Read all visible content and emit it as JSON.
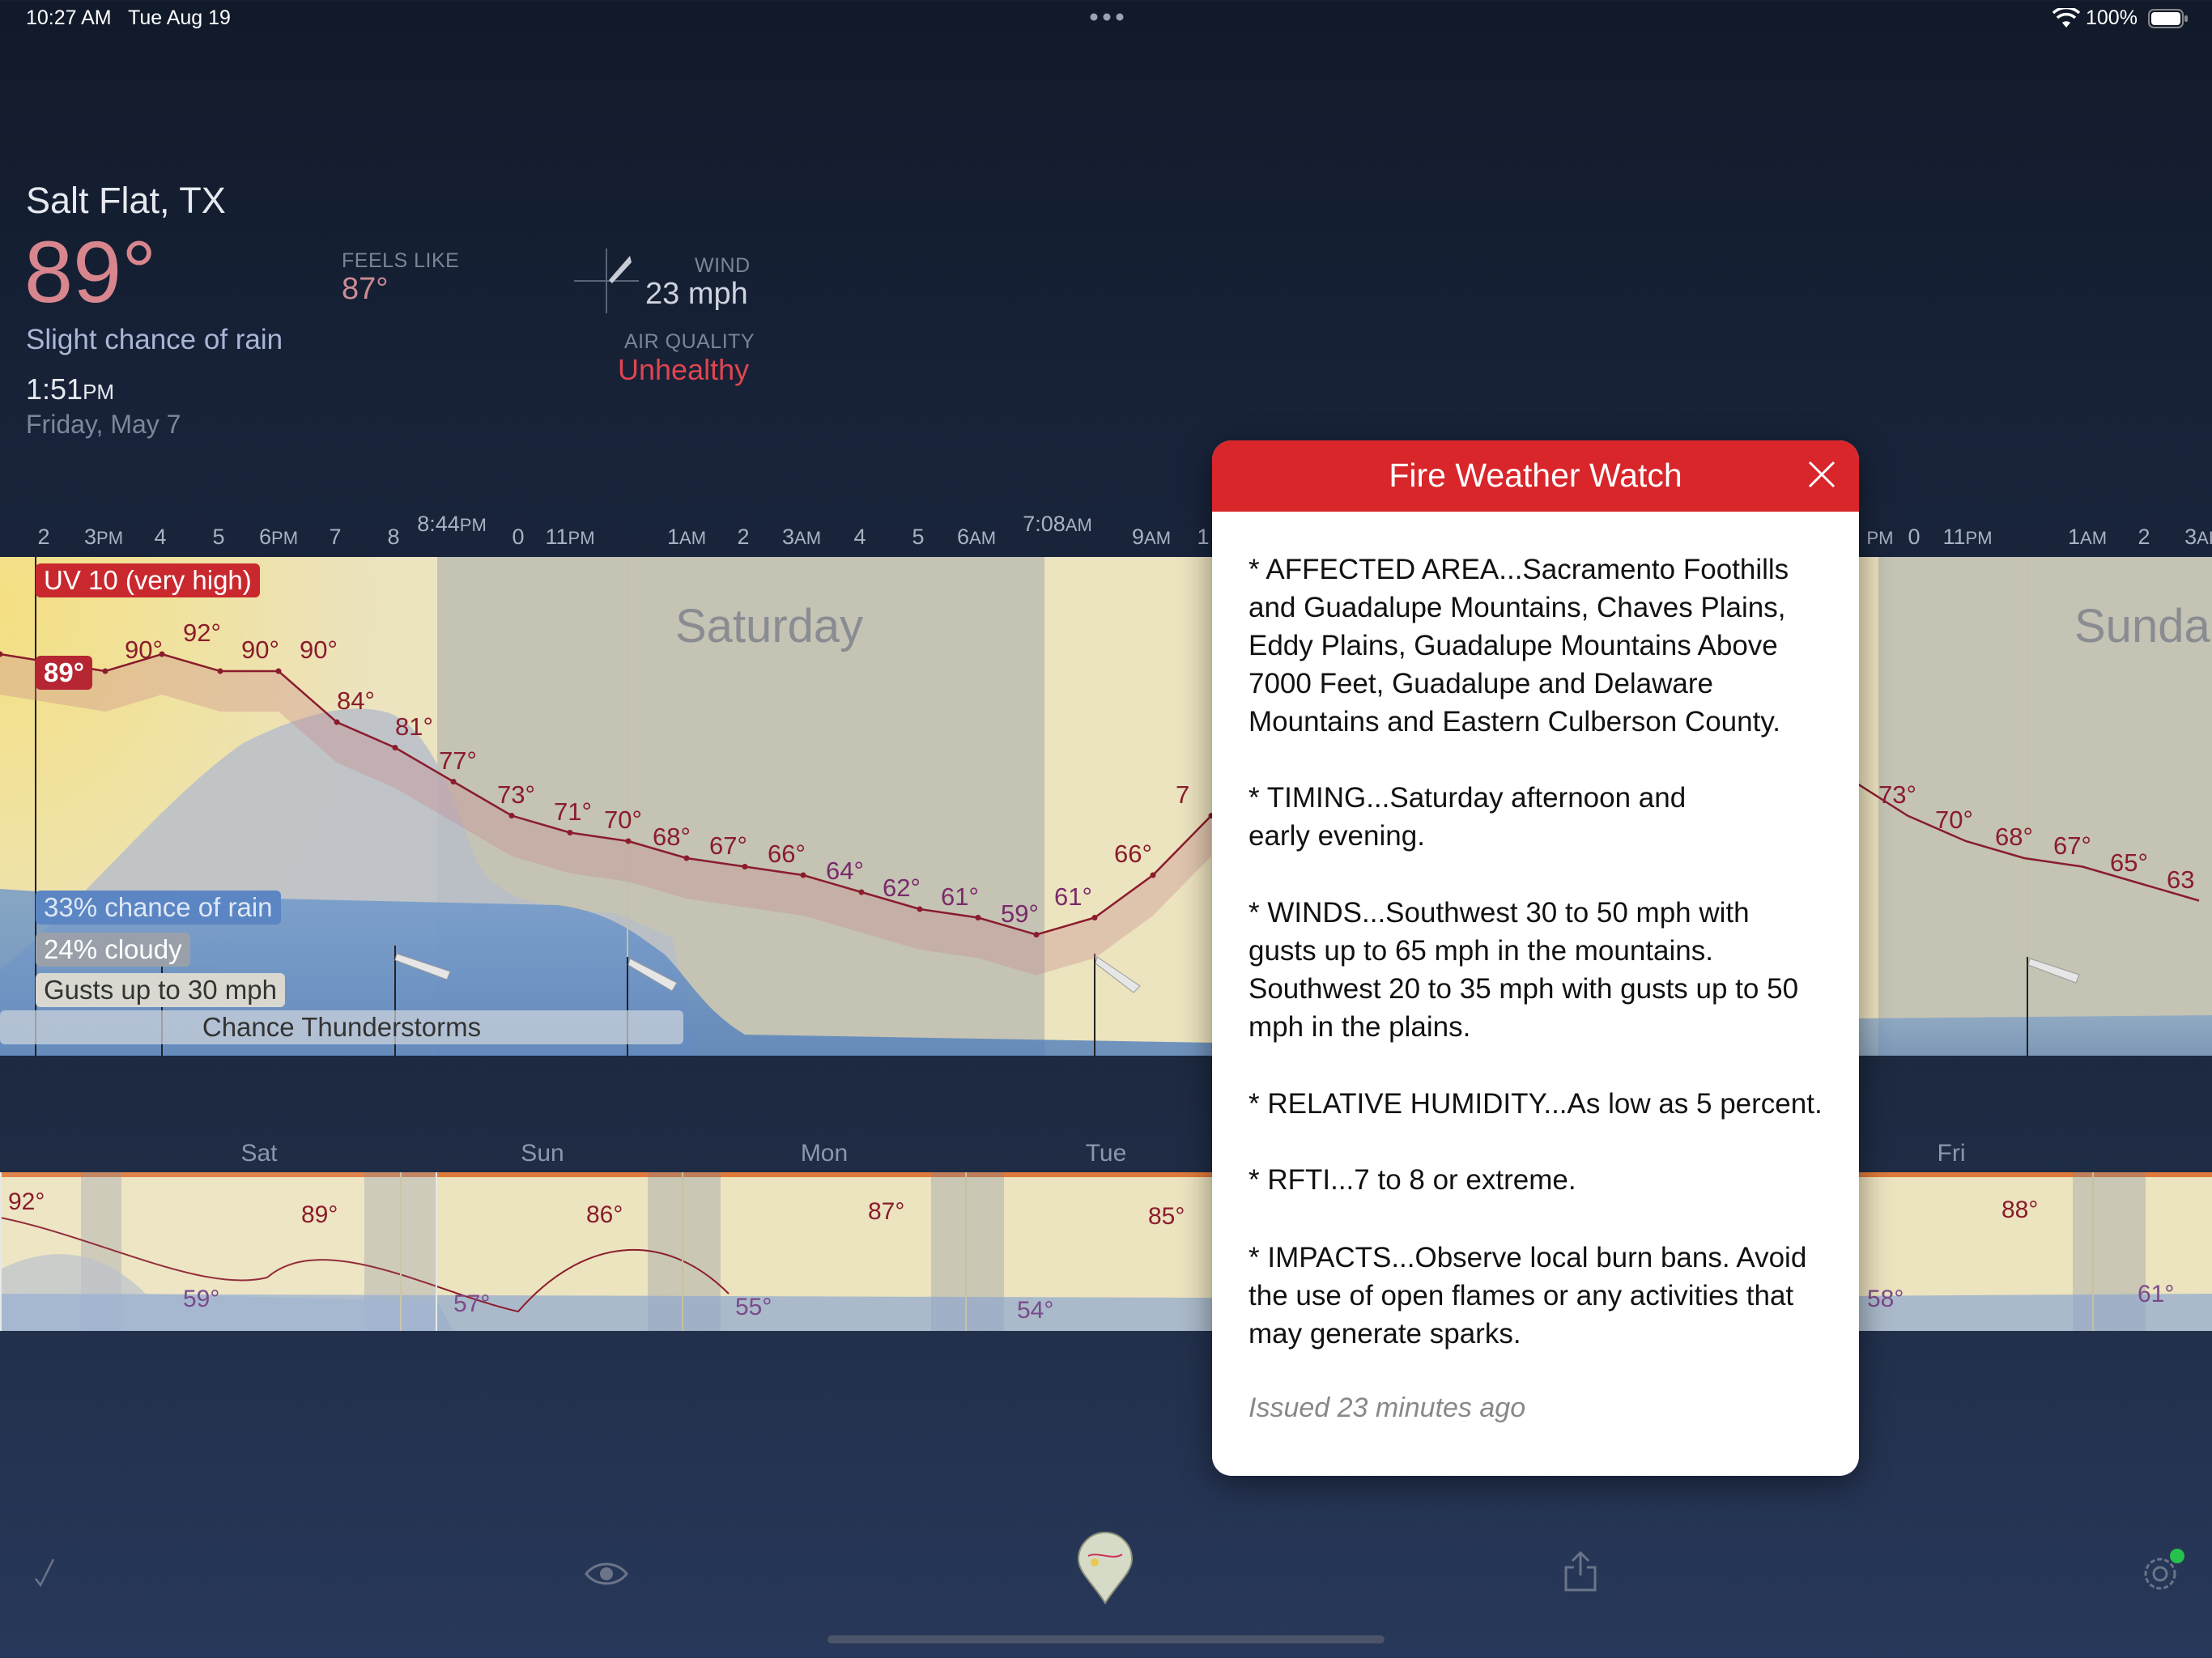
{
  "status": {
    "time": "10:27 AM",
    "date": "Tue Aug 19",
    "battery": "100%"
  },
  "current": {
    "location": "Salt Flat, TX",
    "temp": "89°",
    "condition": "Slight chance of rain",
    "time": "1:51",
    "time_suffix": "PM",
    "date": "Friday, May 7",
    "feels_like_label": "FEELS LIKE",
    "feels_like": "87°",
    "wind_label": "WIND",
    "wind": "23 mph",
    "aq_label": "AIR QUALITY",
    "aq": "Unhealthy"
  },
  "timeline": {
    "ticks": [
      {
        "t": "2",
        "s": ""
      },
      {
        "t": "3",
        "s": "PM"
      },
      {
        "t": "4",
        "s": ""
      },
      {
        "t": "5",
        "s": ""
      },
      {
        "t": "6",
        "s": "PM"
      },
      {
        "t": "7",
        "s": ""
      },
      {
        "t": "8",
        "s": ""
      },
      {
        "t": "8:44",
        "s": "PM"
      },
      {
        "t": "0",
        "s": ""
      },
      {
        "t": "11",
        "s": "PM"
      },
      {
        "t": "1",
        "s": "AM"
      },
      {
        "t": "2",
        "s": ""
      },
      {
        "t": "3",
        "s": "AM"
      },
      {
        "t": "4",
        "s": ""
      },
      {
        "t": "5",
        "s": ""
      },
      {
        "t": "6",
        "s": "AM"
      },
      {
        "t": "7:08",
        "s": "AM"
      },
      {
        "t": "9",
        "s": "AM"
      },
      {
        "t": "1",
        "s": ""
      },
      {
        "t": "",
        "s": "PM"
      },
      {
        "t": "0",
        "s": ""
      },
      {
        "t": "11",
        "s": "PM"
      },
      {
        "t": "1",
        "s": "AM"
      },
      {
        "t": "2",
        "s": ""
      },
      {
        "t": "3",
        "s": "AI"
      }
    ],
    "day_labels": [
      "Saturday",
      "Sunda"
    ],
    "uv": "UV 10 (very high)",
    "rain": "33% chance of rain",
    "cloud": "24% cloudy",
    "gusts": "Gusts up to 30 mph",
    "forecast": "Chance Thunderstorms",
    "current_temp": "89°",
    "temps_left": [
      "90°",
      "92°",
      "90°",
      "90°",
      "84°",
      "81°",
      "77°",
      "73°",
      "71°",
      "70°",
      "68°",
      "67°",
      "66°",
      "64°",
      "62°",
      "61°",
      "59°",
      "61°",
      "66°",
      "7"
    ],
    "temps_right": [
      "°",
      "73°",
      "70°",
      "68°",
      "67°",
      "65°",
      "63"
    ]
  },
  "week": {
    "days": [
      "Sat",
      "Sun",
      "Mon",
      "Tue",
      "Fri"
    ],
    "highs": [
      "92°",
      "89°",
      "86°",
      "87°",
      "85°",
      "88°"
    ],
    "lows": [
      "59°",
      "57°",
      "55°",
      "54°",
      "58°",
      "61°"
    ]
  },
  "alert": {
    "title": "Fire Weather Watch",
    "paragraphs": [
      "* AFFECTED AREA...Sacramento Foothills and Guadalupe Mountains, Chaves Plains, Eddy Plains, Guadalupe Mountains Above 7000 Feet, Guadalupe and Delaware Mountains and Eastern Culberson County.",
      "* TIMING...Saturday afternoon and early evening.",
      "* WINDS...Southwest 30 to 50 mph with gusts up to 65 mph in the mountains. Southwest 20 to 35 mph with gusts up to 50 mph in the plains.",
      "* RELATIVE HUMIDITY...As low as 5 percent.",
      "* RFTI...7 to 8 or extreme.",
      "* IMPACTS...Observe local burn bans. Avoid the use of open flames or any activities that may generate sparks."
    ],
    "issued": "Issued 23 minutes ago"
  },
  "colors": {
    "alert_red": "#d8262b",
    "temp_line": "#8a1c2c",
    "aq_red": "#e0454f"
  },
  "icons": [
    "wifi-icon",
    "battery-icon",
    "more-dots-icon",
    "wind-vane-icon",
    "checkmark-icon",
    "eye-icon",
    "map-pin-icon",
    "share-icon",
    "settings-icon",
    "close-icon"
  ]
}
